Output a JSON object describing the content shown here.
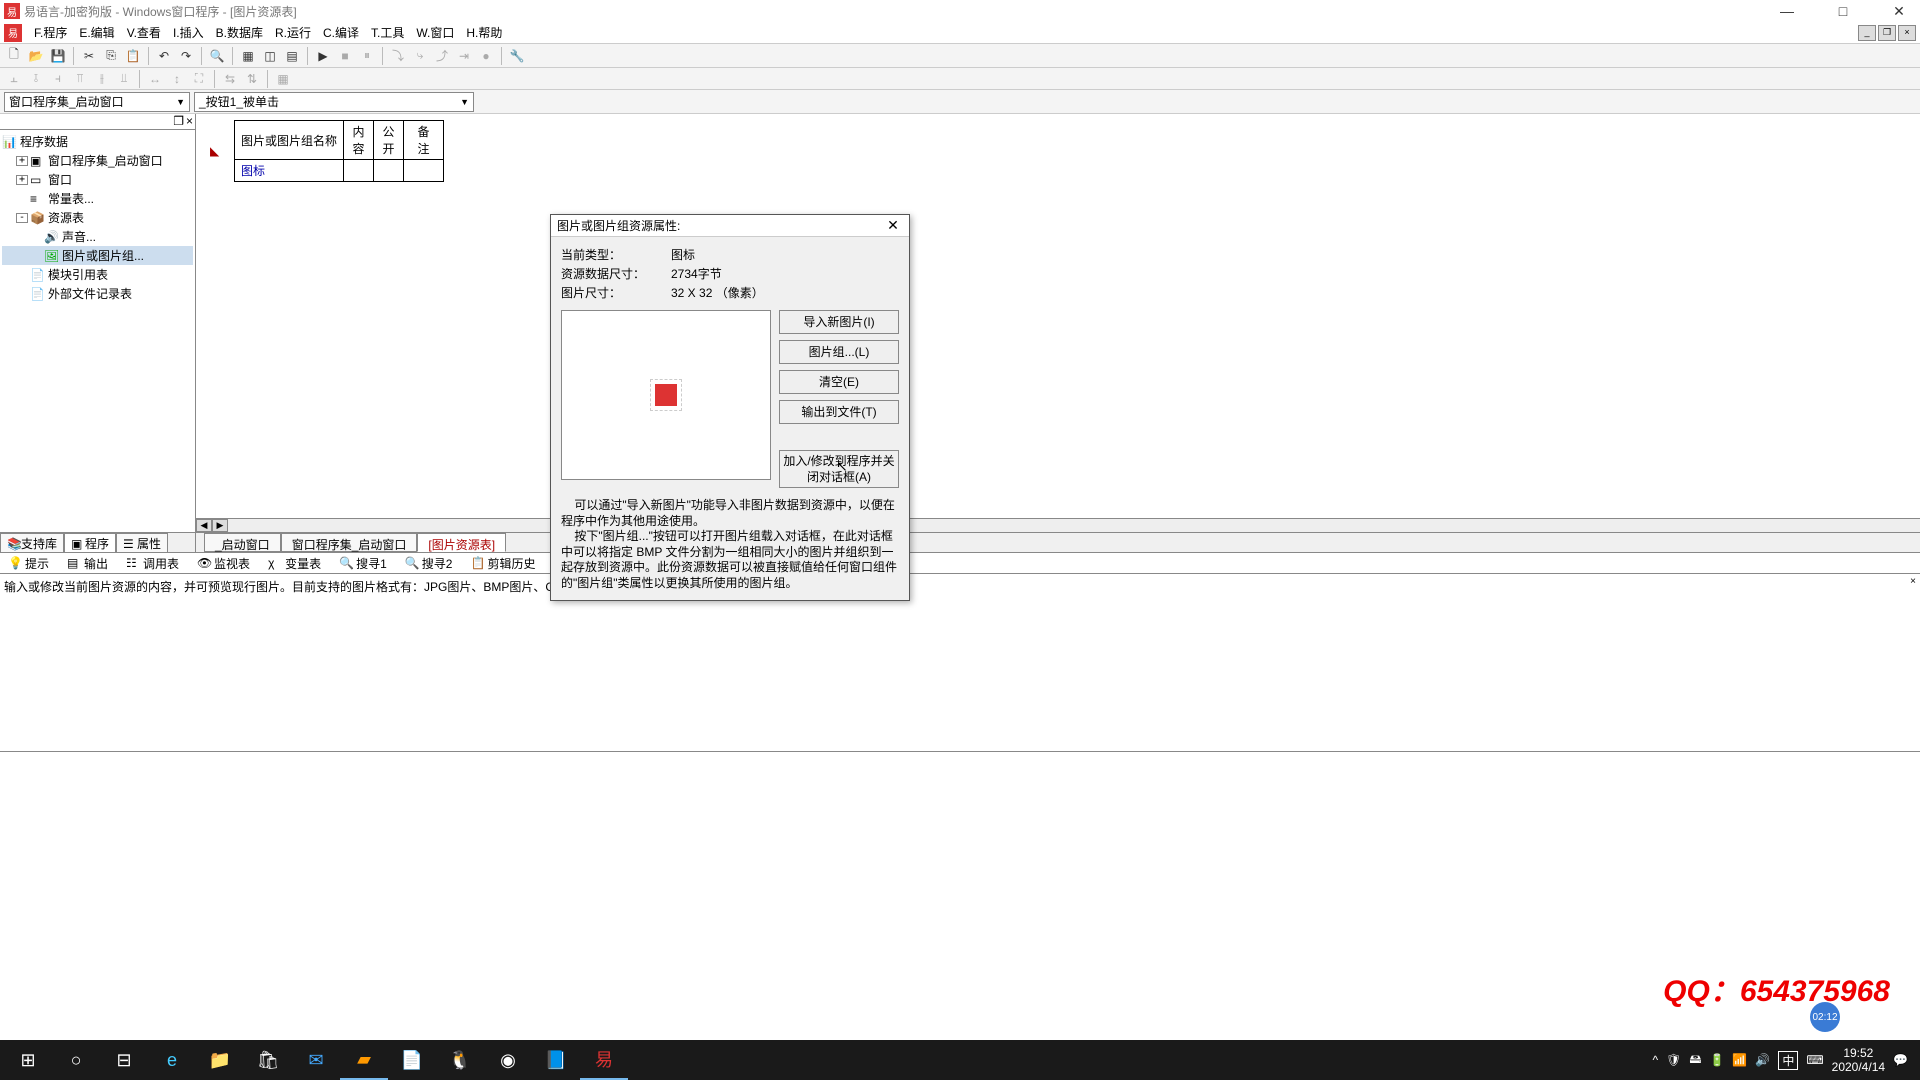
{
  "title": "易语言-加密狗版 - Windows窗口程序 - [图片资源表]",
  "menu": {
    "file": "F.程序",
    "edit": "E.编辑",
    "view": "V.查看",
    "insert": "I.插入",
    "db": "B.数据库",
    "run": "R.运行",
    "compile": "C.编译",
    "tool": "T.工具",
    "window": "W.窗口",
    "help": "H.帮助"
  },
  "combo1": "窗口程序集_启动窗口",
  "combo2": "_按钮1_被单击",
  "tree": {
    "root": "程序数据",
    "n1": "窗口程序集_启动窗口",
    "n2": "窗口",
    "n3": "常量表...",
    "n4": "资源表",
    "n5": "声音...",
    "n6": "图片或图片组...",
    "n7": "模块引用表",
    "n8": "外部文件记录表"
  },
  "left_tabs": {
    "t1": "支持库",
    "t2": "程序",
    "t3": "属性"
  },
  "res_table": {
    "h1": "图片或图片组名称",
    "h2": "内容",
    "h3": "公开",
    "h4": "备 注",
    "r1c1": "图标"
  },
  "doc_tabs": {
    "t1": "_启动窗口",
    "t2": "窗口程序集_启动窗口",
    "t3": "[图片资源表]"
  },
  "bottom_tabs": {
    "tip": "提示",
    "out": "输出",
    "call": "调用表",
    "watch": "监视表",
    "var": "变量表",
    "s1": "搜寻1",
    "s2": "搜寻2",
    "clip": "剪辑历史"
  },
  "output_text": "输入或修改当前图片资源的内容，并可预览现行图片。目前支持的图片格式有：JPG图片、BMP图片、GIF图片、图标、鼠标指针。",
  "modal": {
    "title": "图片或图片组资源属性:",
    "l_type": "当前类型：",
    "v_type": "图标",
    "l_size": "资源数据尺寸：",
    "v_size": "2734字节",
    "l_dim": "图片尺寸：",
    "v_dim": "32 X 32  （像素）",
    "b_import": "导入新图片(I)",
    "b_group": "图片组...(L)",
    "b_clear": "清空(E)",
    "b_export": "输出到文件(T)",
    "b_apply": "加入/修改到程序并关闭对话框(A)",
    "help": "    可以通过\"导入新图片\"功能导入非图片数据到资源中，以便在程序中作为其他用途使用。\n    按下\"图片组...\"按钮可以打开图片组载入对话框，在此对话框中可以将指定 BMP 文件分割为一组相同大小的图片并组织到一起存放到资源中。此份资源数据可以被直接赋值给任何窗口组件的\"图片组\"类属性以更换其所使用的图片组。"
  },
  "watermark": "QQ：654375968",
  "badge": "02:12",
  "clock": {
    "time": "19:52",
    "date": "2020/4/14"
  },
  "ime": "中"
}
